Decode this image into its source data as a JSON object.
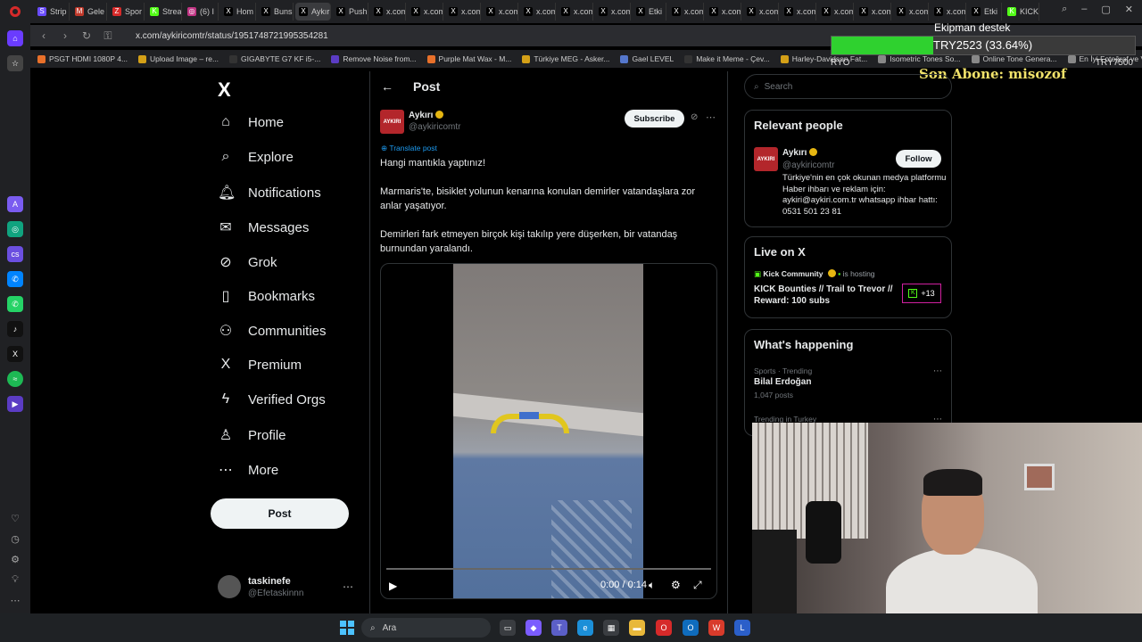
{
  "browser": {
    "tabs": [
      {
        "label": "Strip",
        "color": "#6a4cff",
        "glyph": "S"
      },
      {
        "label": "Gele",
        "color": "#c0392b",
        "glyph": "M"
      },
      {
        "label": "Spor",
        "color": "#d62a2a",
        "glyph": "Z"
      },
      {
        "label": "Strea",
        "color": "#53fc18",
        "glyph": "K"
      },
      {
        "label": "(6) I",
        "color": "#c13584",
        "glyph": "◎"
      },
      {
        "label": "Hom",
        "color": "#000000",
        "glyph": "X"
      },
      {
        "label": "Buns",
        "color": "#000000",
        "glyph": "X"
      },
      {
        "label": "Aykırı on",
        "color": "#000000",
        "glyph": "X"
      },
      {
        "label": "Push",
        "color": "#000000",
        "glyph": "X"
      },
      {
        "label": "x.com",
        "color": "#000000",
        "glyph": "X"
      },
      {
        "label": "x.com",
        "color": "#000000",
        "glyph": "X"
      },
      {
        "label": "x.com",
        "color": "#000000",
        "glyph": "X"
      },
      {
        "label": "x.com",
        "color": "#000000",
        "glyph": "X"
      },
      {
        "label": "x.com",
        "color": "#000000",
        "glyph": "X"
      },
      {
        "label": "x.com",
        "color": "#000000",
        "glyph": "X"
      },
      {
        "label": "x.com",
        "color": "#000000",
        "glyph": "X"
      },
      {
        "label": "Etki",
        "color": "#000000",
        "glyph": "X"
      },
      {
        "label": "x.com",
        "color": "#000000",
        "glyph": "X"
      },
      {
        "label": "x.com",
        "color": "#000000",
        "glyph": "X"
      },
      {
        "label": "x.com",
        "color": "#000000",
        "glyph": "X"
      },
      {
        "label": "x.com",
        "color": "#000000",
        "glyph": "X"
      },
      {
        "label": "x.com",
        "color": "#000000",
        "glyph": "X"
      },
      {
        "label": "x.com",
        "color": "#000000",
        "glyph": "X"
      },
      {
        "label": "x.com",
        "color": "#000000",
        "glyph": "X"
      },
      {
        "label": "x.com",
        "color": "#000000",
        "glyph": "X"
      },
      {
        "label": "Etki",
        "color": "#000000",
        "glyph": "X"
      },
      {
        "label": "KICK",
        "color": "#53fc18",
        "glyph": "K"
      }
    ],
    "active_tab_index": 7,
    "url": "x.com/aykiricomtr/status/1951748721995354281",
    "bookmarks": [
      {
        "label": "PSGT HDMI 1080P 4...",
        "color": "#e8702a"
      },
      {
        "label": "Upload Image – re...",
        "color": "#d4a017"
      },
      {
        "label": "GIGABYTE G7 KF i5-...",
        "color": "#333333"
      },
      {
        "label": "Remove Noise from...",
        "color": "#5b3cc4"
      },
      {
        "label": "Purple Mat Wax - M...",
        "color": "#e8702a"
      },
      {
        "label": "Türkiye MEG - Asker...",
        "color": "#d4a017"
      },
      {
        "label": "Gael LEVEL",
        "color": "#5577cc"
      },
      {
        "label": "Make it Meme - Çev...",
        "color": "#333333"
      },
      {
        "label": "Harley-Davidson Fat...",
        "color": "#d4a017"
      },
      {
        "label": "Isometric Tones So...",
        "color": "#888888"
      },
      {
        "label": "Online Tone Genera...",
        "color": "#888888"
      },
      {
        "label": "En İyi Fotoğraf ve Vi...",
        "color": "#888888"
      }
    ]
  },
  "overlay": {
    "donation_title": "Ekipman destek",
    "donation_label": "TRY2523 (33.64%)",
    "donation_progress": 0.3364,
    "donation_min": "RYO",
    "donation_max": "TRY7500",
    "last_subscriber": "Son Abone: misozof"
  },
  "x_nav": {
    "logo": "X",
    "items": [
      {
        "label": "Home",
        "icon": "⌂",
        "icon_name": "home-icon"
      },
      {
        "label": "Explore",
        "icon": "⌕",
        "icon_name": "explore-icon"
      },
      {
        "label": "Notifications",
        "icon": "🔔︎",
        "icon_name": "bell-icon"
      },
      {
        "label": "Messages",
        "icon": "✉",
        "icon_name": "mail-icon"
      },
      {
        "label": "Grok",
        "icon": "⊘",
        "icon_name": "grok-icon"
      },
      {
        "label": "Bookmarks",
        "icon": "▯",
        "icon_name": "bookmark-icon"
      },
      {
        "label": "Communities",
        "icon": "⚇",
        "icon_name": "communities-icon"
      },
      {
        "label": "Premium",
        "icon": "X",
        "icon_name": "premium-icon"
      },
      {
        "label": "Verified Orgs",
        "icon": "ϟ",
        "icon_name": "lightning-icon"
      },
      {
        "label": "Profile",
        "icon": "♙",
        "icon_name": "profile-icon"
      },
      {
        "label": "More",
        "icon": "⋯",
        "icon_name": "more-icon"
      }
    ],
    "post_button": "Post",
    "account_name": "taskinefe",
    "account_handle": "@Efetaskinnn"
  },
  "post": {
    "header_title": "Post",
    "author_name": "Aykırı",
    "author_handle": "@aykiricomtr",
    "avatar_text": "AYKIRI",
    "subscribe_label": "Subscribe",
    "translate_label": "Translate post",
    "paragraphs": [
      "Hangi mantıkla yaptınız!",
      "Marmaris'te, bisiklet yolunun kenarına konulan demirler vatandaşlara zor anlar yaşatıyor.",
      "Demirleri fark etmeyen birçok kişi takılıp yere düşerken, bir vatandaş burnundan yaralandı."
    ],
    "video_time": "0:00 / 0:14",
    "video_progress": 0.0
  },
  "sidebar": {
    "search_placeholder": "Search",
    "relevant_title": "Relevant people",
    "rp_name": "Aykırı",
    "rp_handle": "@aykiricomtr",
    "rp_follow": "Follow",
    "rp_bio": "Türkiye'nin en çok okunan medya platformu Haber ihbarı ve reklam için: aykiri@aykiri.com.tr whatsapp ihbar hattı: 0531 501 23 81",
    "live_title": "Live on X",
    "live_host": "Kick Community",
    "live_status": "is hosting",
    "live_stream_title": "KICK Bounties // Trail to Trevor // Reward: 100 subs",
    "live_count": "+13",
    "happening_title": "What's happening",
    "trends": [
      {
        "meta": "Sports · Trending",
        "name": "Bilal Erdoğan",
        "count": "1,047 posts"
      },
      {
        "meta": "Trending in Turkey",
        "name": "",
        "count": ""
      }
    ]
  },
  "taskbar": {
    "search_label": "Ara",
    "apps": [
      {
        "name": "task-view",
        "color": "#3a3d41",
        "glyph": "▭"
      },
      {
        "name": "copilot",
        "color": "#7b5cff",
        "glyph": "◆"
      },
      {
        "name": "teams",
        "color": "#5b5fc7",
        "glyph": "T"
      },
      {
        "name": "edge",
        "color": "#1c8fd8",
        "glyph": "e"
      },
      {
        "name": "store",
        "color": "#3a3d41",
        "glyph": "▦"
      },
      {
        "name": "file-explorer",
        "color": "#e8b83a",
        "glyph": "▬"
      },
      {
        "name": "opera",
        "color": "#d62a2a",
        "glyph": "O"
      },
      {
        "name": "outlook",
        "color": "#0f6cbd",
        "glyph": "O"
      },
      {
        "name": "office",
        "color": "#d83b2b",
        "glyph": "W"
      },
      {
        "name": "launcher",
        "color": "#2b5fc9",
        "glyph": "L"
      }
    ]
  }
}
